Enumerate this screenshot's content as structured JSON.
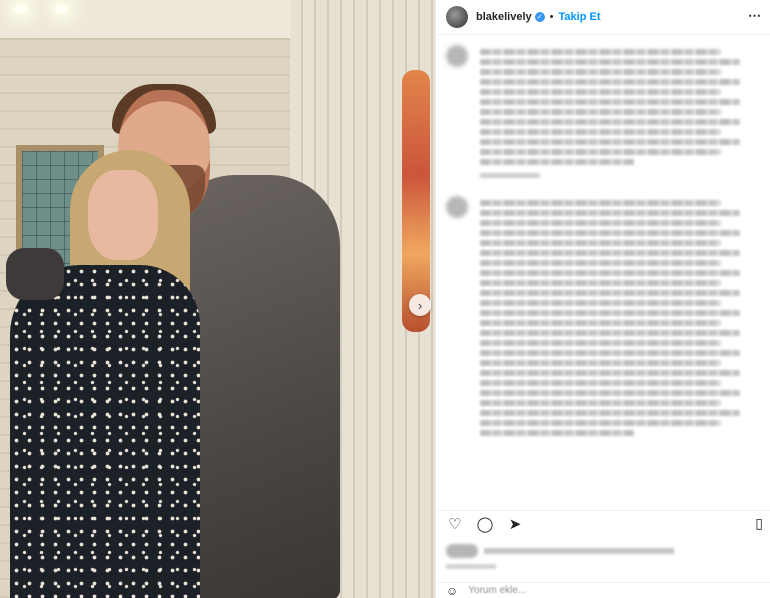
{
  "post": {
    "username": "blakelively",
    "verified_mark": "✓",
    "separator": "•",
    "follow_label": "Takip Et",
    "more_label": "⋯",
    "next_arrow": "›"
  },
  "caption": {
    "line_count": 12
  },
  "comment": {
    "line_count": 24
  },
  "actions": {
    "like_icon": "♡",
    "comment_icon": "◯",
    "share_icon": "➤",
    "bookmark_icon": "▯"
  },
  "add_comment": {
    "emoji_icon": "☺",
    "placeholder": "Yorum ekle..."
  },
  "colors": {
    "link_blue": "#0095f6",
    "verified_blue": "#3897f0",
    "text": "#262626"
  }
}
